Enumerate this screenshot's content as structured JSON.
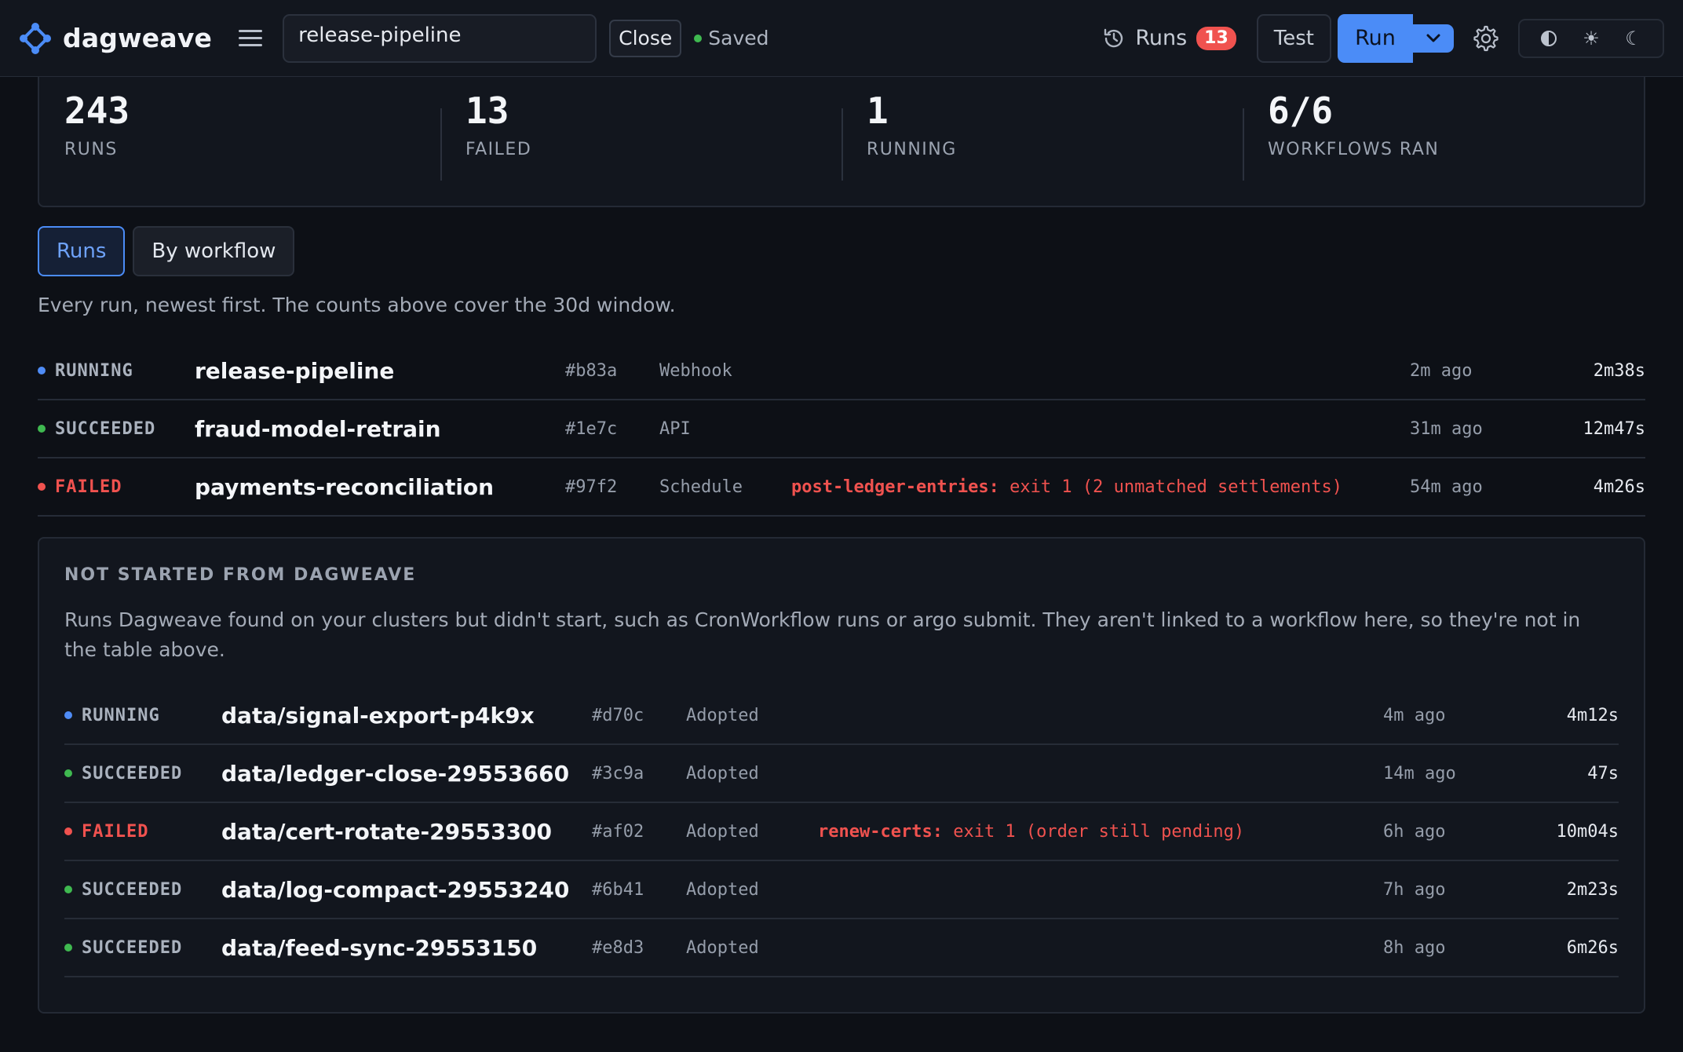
{
  "app": {
    "name": "dagweave"
  },
  "toolbar": {
    "workflow_name": "release-pipeline",
    "close_label": "Close",
    "saved_label": "Saved",
    "runs_label": "Runs",
    "runs_count": "13",
    "test_label": "Test",
    "run_label": "Run"
  },
  "stats": [
    {
      "value": "243",
      "label": "RUNS"
    },
    {
      "value": "13",
      "label": "FAILED"
    },
    {
      "value": "1",
      "label": "RUNNING"
    },
    {
      "value": "6/6",
      "label": "WORKFLOWS RAN"
    }
  ],
  "tabs": [
    {
      "label": "Runs",
      "active": true
    },
    {
      "label": "By workflow",
      "active": false
    }
  ],
  "intro": "Every run, newest first. The counts above cover the 30d window.",
  "runs": [
    {
      "status": "RUNNING",
      "name": "release-pipeline",
      "id": "#b83a",
      "trigger": "Webhook",
      "error_step": "",
      "error_msg": "",
      "ago": "2m ago",
      "duration": "2m38s"
    },
    {
      "status": "SUCCEEDED",
      "name": "fraud-model-retrain",
      "id": "#1e7c",
      "trigger": "API",
      "error_step": "",
      "error_msg": "",
      "ago": "31m ago",
      "duration": "12m47s"
    },
    {
      "status": "FAILED",
      "name": "payments-reconciliation",
      "id": "#97f2",
      "trigger": "Schedule",
      "error_step": "post-ledger-entries:",
      "error_msg": "exit 1 (2 unmatched settlements)",
      "ago": "54m ago",
      "duration": "4m26s"
    }
  ],
  "adopted": {
    "title": "NOT STARTED FROM DAGWEAVE",
    "description": "Runs Dagweave found on your clusters but didn't start, such as CronWorkflow runs or argo submit. They aren't linked to a workflow here, so they're not in the table above.",
    "runs": [
      {
        "status": "RUNNING",
        "name": "data/signal-export-p4k9x",
        "id": "#d70c",
        "trigger": "Adopted",
        "error_step": "",
        "error_msg": "",
        "ago": "4m ago",
        "duration": "4m12s"
      },
      {
        "status": "SUCCEEDED",
        "name": "data/ledger-close-29553660",
        "id": "#3c9a",
        "trigger": "Adopted",
        "error_step": "",
        "error_msg": "",
        "ago": "14m ago",
        "duration": "47s"
      },
      {
        "status": "FAILED",
        "name": "data/cert-rotate-29553300",
        "id": "#af02",
        "trigger": "Adopted",
        "error_step": "renew-certs:",
        "error_msg": "exit 1 (order still pending)",
        "ago": "6h ago",
        "duration": "10m04s"
      },
      {
        "status": "SUCCEEDED",
        "name": "data/log-compact-29553240",
        "id": "#6b41",
        "trigger": "Adopted",
        "error_step": "",
        "error_msg": "",
        "ago": "7h ago",
        "duration": "2m23s"
      },
      {
        "status": "SUCCEEDED",
        "name": "data/feed-sync-29553150",
        "id": "#e8d3",
        "trigger": "Adopted",
        "error_step": "",
        "error_msg": "",
        "ago": "8h ago",
        "duration": "6m26s"
      }
    ]
  },
  "icons": {
    "logo": "diamond-nodes-icon",
    "menu": "hamburger-icon",
    "history": "history-icon",
    "dropdown": "chevron-down-icon",
    "settings": "gear-icon",
    "theme_auto": "contrast-icon",
    "theme_light": "sun-icon",
    "theme_dark": "moon-icon"
  },
  "colors": {
    "accent": "#4b8cf7",
    "success": "#3fb950",
    "danger": "#f0524f",
    "running": "#4f8cf6",
    "background": "#0d1016",
    "surface": "#12161e"
  }
}
